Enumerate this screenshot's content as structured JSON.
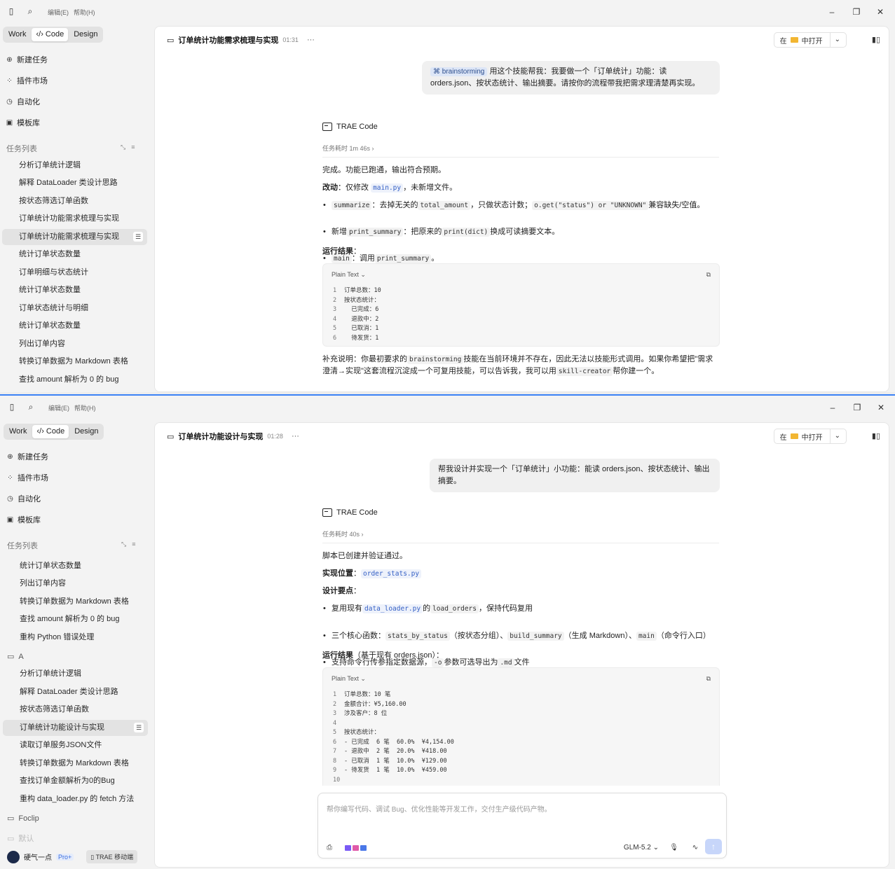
{
  "app": {
    "menu_edit": "编辑(E)",
    "menu_help": "帮助(H)",
    "tabs": [
      "Work",
      "Code",
      "Design"
    ],
    "nav": [
      {
        "icon": "plus-circle-icon",
        "label": "新建任务"
      },
      {
        "icon": "puzzle-icon",
        "label": "插件市场"
      },
      {
        "icon": "clock-icon",
        "label": "自动化"
      },
      {
        "icon": "template-icon",
        "label": "模板库"
      }
    ],
    "task_list_title": "任务列表",
    "open_in": "在",
    "open_target": "中打开"
  },
  "window1": {
    "tasks": [
      "分析订单统计逻辑",
      "解释 DataLoader 类设计思路",
      "按状态筛选订单函数",
      "订单统计功能需求梳理与实现",
      "订单统计功能需求梳理与实现",
      "统计订单状态数量",
      "订单明细与状态统计",
      "统计订单状态数量",
      "订单状态统计与明细",
      "统计订单状态数量",
      "列出订单内容",
      "转换订单数据为 Markdown 表格",
      "查找 amount 解析为 0 的 bug"
    ],
    "selected_index": 4,
    "title": "订单统计功能需求梳理与实现",
    "time": "01:31",
    "user_skill": "brainstorming",
    "user_msg": "用这个技能帮我：我要做一个「订单统计」功能：读 orders.json、按状态统计、输出摘要。请按你的流程带我把需求理清楚再实现。",
    "ai_name": "TRAE Code",
    "duration": "任务耗时 1m 46s",
    "done": "完成。功能已跑通，输出符合预期。",
    "change_label": "改动",
    "change_pre": "：仅修改",
    "change_file": "main.py",
    "change_post": "，未新增文件。",
    "b1_code1": "summarize",
    "b1_t1": "：去掉无关的",
    "b1_code2": "total_amount",
    "b1_t2": "，只做状态计数；",
    "b1_code3": "o.get(\"status\") or \"UNKNOWN\"",
    "b1_t3": "兼容缺失/空值。",
    "b2_t1": "新增",
    "b2_code1": "print_summary",
    "b2_t2": "：把原来的",
    "b2_code2": "print(dict)",
    "b2_t3": "换成可读摘要文本。",
    "b3_code1": "main",
    "b3_t1": "：调用",
    "b3_code2": "print_summary",
    "b3_t2": "。",
    "result_label": "运行结果",
    "result_colon": "：",
    "code_lang": "Plain Text",
    "code_lines": [
      "订单总数：10",
      "按状态统计：",
      "  已完成：6",
      "  退款中：2",
      "  已取消：1",
      "  待发货：1"
    ],
    "note_t1": "补充说明：你最初要求的",
    "note_code1": "brainstorming",
    "note_t2": "技能在当前环境并不存在，因此无法以技能形式调用。如果你希望把\"需求澄清→实现\"这套流程沉淀成一个可复用技能，可以告诉我，我可以用",
    "note_code2": "skill-creator",
    "note_t3": "帮你建一个。"
  },
  "window2": {
    "tasks_top": [
      "统计订单状态数量",
      "列出订单内容",
      "转换订单数据为 Markdown 表格",
      "查找 amount 解析为 0 的 bug",
      "重构 Python 错误处理"
    ],
    "group_a": "A",
    "tasks_a": [
      "分析订单统计逻辑",
      "解释 DataLoader 类设计思路",
      "按状态筛选订单函数",
      "订单统计功能设计与实现",
      "读取订单服务JSON文件",
      "转换订单数据为 Markdown 表格",
      "查找订单金额解析为0的Bug",
      "重构 data_loader.py 的 fetch 方法"
    ],
    "selected_index_a": 3,
    "group_foclip": "Foclip",
    "group_faded": "默认",
    "user_name": "硬气一点",
    "pro": "Pro+",
    "mobile": "TRAE 移动端",
    "title": "订单统计功能设计与实现",
    "time": "01:28",
    "user_msg": "帮我设计并实现一个「订单统计」小功能：能读 orders.json、按状态统计、输出摘要。",
    "ai_name": "TRAE Code",
    "duration": "任务耗时 40s",
    "done": "脚本已创建并验证通过。",
    "loc_label": "实现位置",
    "loc_colon": "：",
    "loc_file": "order_stats.py",
    "design_label": "设计要点",
    "design_colon": "：",
    "b1_t1": "复用现有",
    "b1_code1": "data_loader.py",
    "b1_t2": "的",
    "b1_code2": "load_orders",
    "b1_t3": "，保持代码复用",
    "b2_t1": "三个核心函数：",
    "b2_code1": "stats_by_status",
    "b2_t2": "（按状态分组）、",
    "b2_code2": "build_summary",
    "b2_t3": "（生成 Markdown）、",
    "b2_code3": "main",
    "b2_t4": "（命令行入口）",
    "b3_t1": "支持命令行传参指定数据源，",
    "b3_code1": "-o",
    "b3_t2": "参数可选导出为",
    "b3_code2": ".md",
    "b3_t3": "文件",
    "result_label": "运行结果",
    "result_note": "（基于现有 orders.json）：",
    "code_lang": "Plain Text",
    "code_lines": [
      "订单总数：10 笔",
      "金额合计：¥5,160.00",
      "涉及客户：8 位",
      "",
      "按状态统计：",
      "- 已完成  6 笔  60.0%  ¥4,154.00",
      "- 退款中  2 笔  20.0%  ¥418.00",
      "- 已取消  1 笔  10.0%  ¥129.00",
      "- 待发货  1 笔  10.0%  ¥459.00",
      ""
    ],
    "composer_placeholder": "帮你编写代码、调试 Bug、优化性能等开发工作，交付生产级代码产物。",
    "model": "GLM-5.2"
  }
}
